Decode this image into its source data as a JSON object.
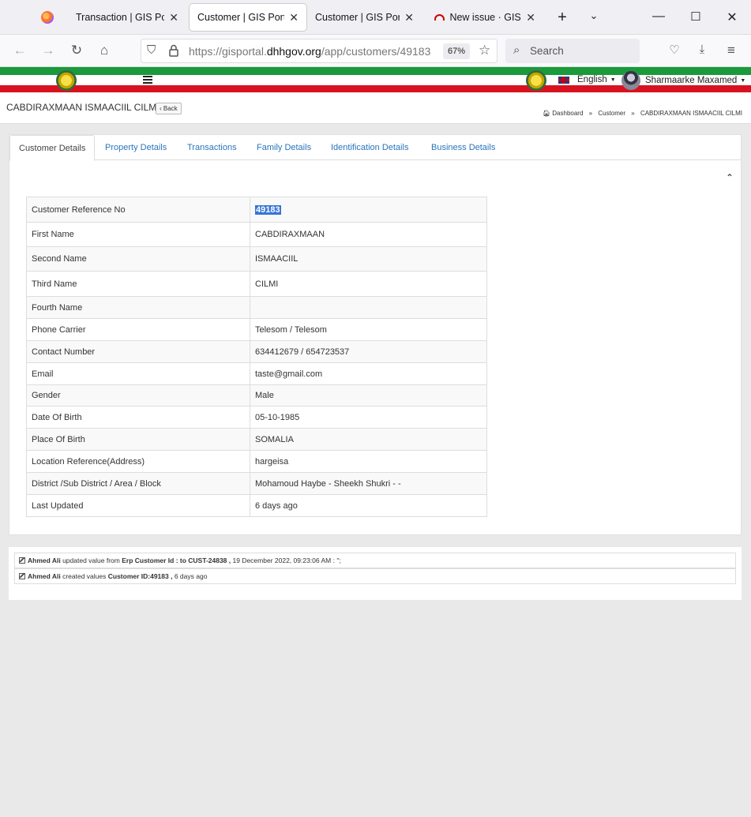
{
  "browser": {
    "tabs": [
      {
        "title": "Transaction | GIS Portal"
      },
      {
        "title": "Customer | GIS Portal"
      },
      {
        "title": "Customer | GIS Portal"
      },
      {
        "title": "New issue · GIS-HR"
      }
    ],
    "url_prefix": "https://gisportal.",
    "url_domain": "dhhgov.org",
    "url_path": "/app/customers/49183",
    "zoom": "67%",
    "search_placeholder": "Search"
  },
  "header": {
    "language": "English",
    "user_name": "Sharmaarke Maxamed"
  },
  "page": {
    "title": "CABDIRAXMAAN ISMAACIIL CILMI",
    "back_label": "Back",
    "breadcrumb": [
      "Dashboard",
      "Customer",
      "CABDIRAXMAAN ISMAACIIL CILMI"
    ]
  },
  "tabs": [
    "Customer Details",
    "Property Details",
    "Transactions",
    "Family Details",
    "Identification Details",
    "Business Details"
  ],
  "details": [
    {
      "label": "Customer Reference No",
      "value": "49183"
    },
    {
      "label": "First Name",
      "value": "CABDIRAXMAAN"
    },
    {
      "label": "Second Name",
      "value": "ISMAACIIL"
    },
    {
      "label": "Third Name",
      "value": "CILMI"
    },
    {
      "label": "Fourth Name",
      "value": ""
    },
    {
      "label": "Phone Carrier",
      "value": "Telesom / Telesom"
    },
    {
      "label": "Contact Number",
      "value": "634412679 / 654723537"
    },
    {
      "label": "Email",
      "value": "taste@gmail.com"
    },
    {
      "label": "Gender",
      "value": "Male"
    },
    {
      "label": "Date Of Birth",
      "value": "05-10-1985"
    },
    {
      "label": "Place Of Birth",
      "value": "SOMALIA"
    },
    {
      "label": "Location Reference(Address)",
      "value": "hargeisa"
    },
    {
      "label": "District /Sub District / Area / Block",
      "value": "Mohamoud Haybe - Sheekh Shukri - -"
    },
    {
      "label": "Last Updated",
      "value": "6 days ago"
    }
  ],
  "logs": [
    {
      "user": "Ahmed Ali",
      "action": " updated value from ",
      "field": "Erp Customer Id : to CUST-24838 ,",
      "rest": " 19 December 2022, 09:23:06 AM : '';"
    },
    {
      "user": "Ahmed Ali",
      "action": " created values ",
      "field": "Customer ID:49183 ,",
      "rest": " 6 days ago"
    }
  ]
}
